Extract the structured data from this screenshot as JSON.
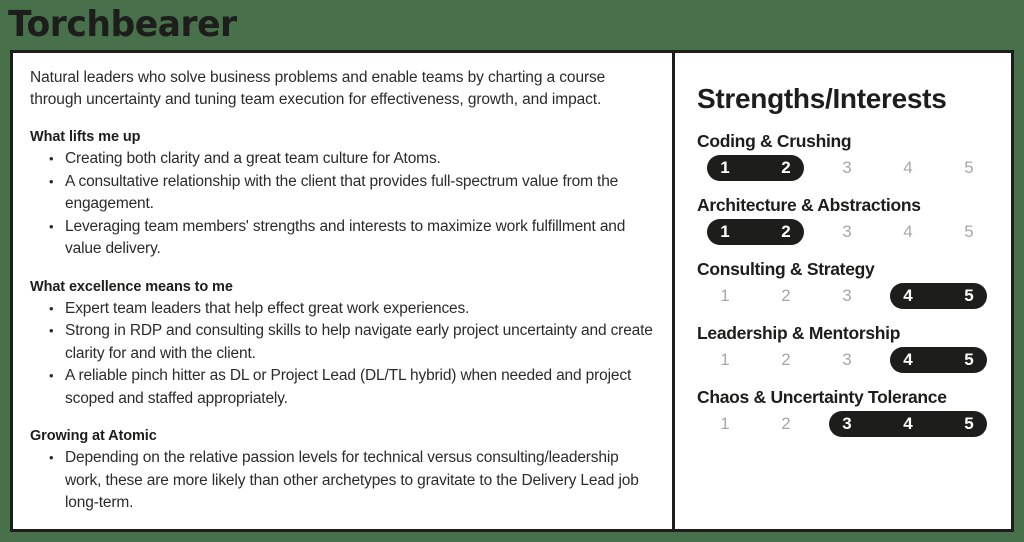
{
  "theme": {
    "background_green": "#47704b",
    "ink": "#1d1d1b",
    "card_white": "#ffffff",
    "muted_number": "#a8a8a8",
    "pill_fill": "#1d1d1b"
  },
  "header": {
    "title": "Torchbearer"
  },
  "left": {
    "intro": "Natural leaders who solve business problems and enable teams by charting a course through uncertainty and tuning team execution for effectiveness, growth, and impact.",
    "sections": [
      {
        "heading": "What lifts me up",
        "bullets": [
          "Creating both clarity and a great team culture for Atoms.",
          "A consultative relationship with the client that provides full-spectrum value from the engagement.",
          "Leveraging team members' strengths and interests to maximize work fulfillment and value delivery."
        ]
      },
      {
        "heading": "What excellence means to me",
        "bullets": [
          "Expert team leaders that help effect great work experiences.",
          "Strong in RDP and consulting skills to help navigate early project uncertainty and create clarity for and with the client.",
          "A reliable pinch hitter as DL or Project Lead (DL/TL hybrid) when needed and project scoped and staffed appropriately."
        ]
      },
      {
        "heading": "Growing at Atomic",
        "bullets": [
          "Depending on the relative passion levels for technical versus consulting/leadership work, these are more likely than other archetypes to gravitate to the Delivery Lead job long-term."
        ]
      }
    ]
  },
  "right": {
    "panel_title": "Strengths/Interests",
    "scale_labels": [
      "1",
      "2",
      "3",
      "4",
      "5"
    ],
    "skills": [
      {
        "name": "Coding & Crushing",
        "range_start": 1,
        "range_end": 2
      },
      {
        "name": "Architecture & Abstractions",
        "range_start": 1,
        "range_end": 2
      },
      {
        "name": "Consulting & Strategy",
        "range_start": 4,
        "range_end": 5
      },
      {
        "name": "Leadership & Mentorship",
        "range_start": 4,
        "range_end": 5
      },
      {
        "name": "Chaos & Uncertainty Tolerance",
        "range_start": 3,
        "range_end": 5
      }
    ]
  }
}
